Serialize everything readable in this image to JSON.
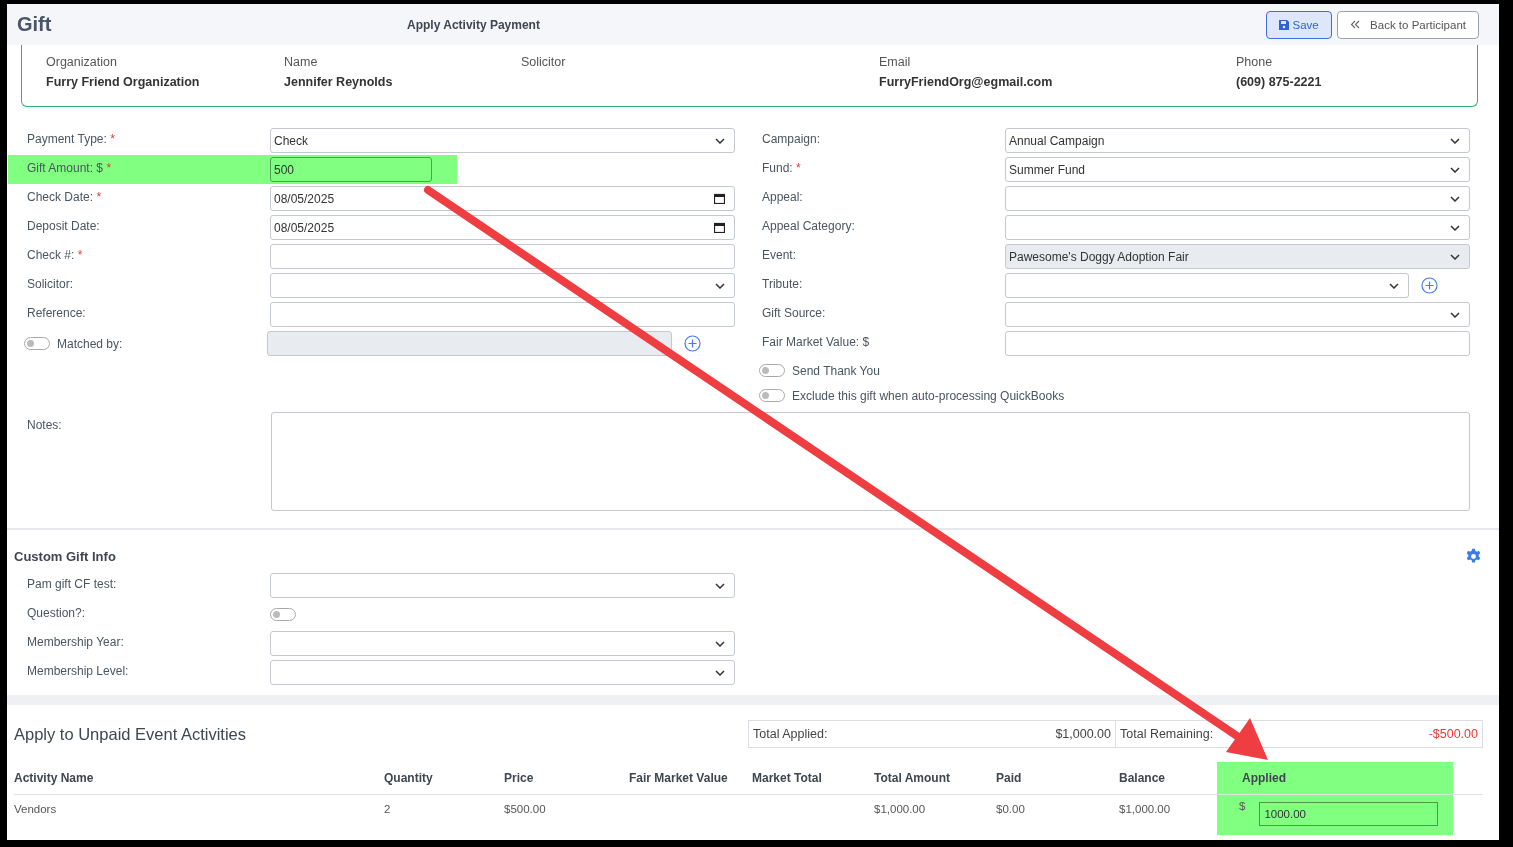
{
  "header": {
    "title": "Gift",
    "subtitle": "Apply Activity Payment",
    "buttons": [
      {
        "kind": "save",
        "label": "Save"
      },
      {
        "kind": "back",
        "label": "Back to Participant"
      }
    ]
  },
  "participant": [
    {
      "label": "Organization",
      "value": "Furry Friend Organization"
    },
    {
      "label": "Name",
      "value": "Jennifer Reynolds"
    },
    {
      "label": "Solicitor"
    },
    {
      "label": "Email",
      "value": "FurryFriendOrg@egmail.com"
    },
    {
      "label": "Phone",
      "value": "(609) 875-2221"
    }
  ],
  "form_left": [
    {
      "kind": "select",
      "label": "Payment Type:",
      "mark": "*",
      "value": "Check",
      "disabled": false
    },
    {
      "kind": "input",
      "label": "Gift Amount: $",
      "mark": "*",
      "value": "500",
      "highlighted": true,
      "disabled": false
    },
    {
      "kind": "date",
      "label": "Check Date:",
      "mark": "*",
      "value": "08/05/2025",
      "disabled": false
    },
    {
      "kind": "date",
      "label": "Deposit Date:",
      "value": "08/05/2025",
      "disabled": false
    },
    {
      "kind": "input",
      "label": "Check #:",
      "mark": "*",
      "disabled": false
    },
    {
      "kind": "select",
      "label": "Solicitor:",
      "disabled": false
    },
    {
      "kind": "input",
      "label": "Reference:",
      "disabled": false
    },
    {
      "kind": "matched",
      "label": "Matched by:",
      "on": false,
      "disabled": true
    }
  ],
  "form_right": [
    {
      "kind": "select",
      "label": "Campaign:",
      "value": "Annual Campaign",
      "disabled": false
    },
    {
      "kind": "select",
      "label": "Fund:",
      "mark": "*",
      "value": "Summer Fund",
      "disabled": false
    },
    {
      "kind": "select",
      "label": "Appeal:",
      "disabled": false
    },
    {
      "kind": "select",
      "label": "Appeal Category:",
      "disabled": false
    },
    {
      "kind": "select",
      "label": "Event:",
      "value": "Pawesome's Doggy Adoption Fair",
      "disabled": true
    },
    {
      "kind": "select-add",
      "label": "Tribute:",
      "disabled": false
    },
    {
      "kind": "select",
      "label": "Gift Source:",
      "disabled": false
    },
    {
      "kind": "input",
      "label": "Fair Market Value: $",
      "disabled": false
    },
    {
      "kind": "toggle",
      "label": "Send Thank You",
      "on": false
    },
    {
      "kind": "toggle",
      "label": "Exclude this gift when auto-processing QuickBooks",
      "on": false
    }
  ],
  "notes": {
    "label": "Notes:"
  },
  "custom": {
    "title": "Custom Gift Info",
    "rows": [
      {
        "kind": "select",
        "label": "Pam gift CF test:",
        "disabled": false
      },
      {
        "kind": "toggle-field",
        "label": "Question?:",
        "on": false
      },
      {
        "kind": "select",
        "label": "Membership Year:",
        "disabled": false
      },
      {
        "kind": "select",
        "label": "Membership Level:",
        "disabled": false
      }
    ]
  },
  "activities": {
    "title": "Apply to Unpaid Event Activities",
    "totals": [
      {
        "label": "Total Applied:",
        "value": "$1,000.00",
        "negative": false
      },
      {
        "label": "Total Remaining:",
        "value": "-$500.00",
        "negative": true
      }
    ],
    "columns": [
      {
        "label": "Activity Name",
        "highlighted": false
      },
      {
        "label": "Quantity",
        "highlighted": false
      },
      {
        "label": "Price",
        "highlighted": false
      },
      {
        "label": "Fair Market Value",
        "highlighted": false
      },
      {
        "label": "Market Total",
        "highlighted": false
      },
      {
        "label": "Total Amount",
        "highlighted": false
      },
      {
        "label": "Paid",
        "highlighted": false
      },
      {
        "label": "Balance",
        "highlighted": false
      },
      {
        "label": "Applied",
        "highlighted": true
      }
    ],
    "rows": [
      {
        "cells": [
          {
            "kind": "text",
            "text": "Vendors"
          },
          {
            "kind": "text",
            "text": "2"
          },
          {
            "kind": "text",
            "text": "$500.00"
          },
          {
            "kind": "empty"
          },
          {
            "kind": "empty"
          },
          {
            "kind": "text",
            "text": "$1,000.00"
          },
          {
            "kind": "text",
            "text": "$0.00"
          },
          {
            "kind": "text",
            "text": "$1,000.00"
          },
          {
            "kind": "input",
            "prefix": "$",
            "value": "1000.00"
          }
        ]
      }
    ]
  }
}
